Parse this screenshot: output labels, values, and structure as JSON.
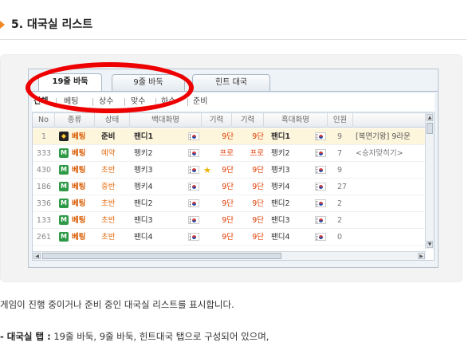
{
  "section": {
    "title": "5. 대국실 리스트"
  },
  "app": {
    "tabs": [
      {
        "label": "19줄 바둑",
        "active": true
      },
      {
        "label": "9줄 바둑",
        "active": false
      },
      {
        "label": "힌트 대국",
        "active": false
      }
    ],
    "filters": [
      {
        "label": "전체",
        "active": true
      },
      {
        "label": "베팅",
        "active": false
      },
      {
        "label": "상수",
        "active": false
      },
      {
        "label": "맞수",
        "active": false
      },
      {
        "label": "하수",
        "active": false
      },
      {
        "label": "준비",
        "active": false
      }
    ],
    "columns": [
      "No",
      "종류",
      "상태",
      "백대화명",
      "기력",
      "기력",
      "흑대화명",
      "인원"
    ],
    "rows": [
      {
        "no": "1",
        "icon": "gold-bet-icon",
        "type": "베팅",
        "status": "준비",
        "black": "팬디1",
        "star": false,
        "rank1": "9단",
        "rank2": "9단",
        "white": "팬디1",
        "viewers": "9",
        "note": "[복면기왕] 9라운",
        "highlight": true
      },
      {
        "no": "333",
        "icon": "m-icon",
        "type": "베팅",
        "status": "예약",
        "black": "펭키2",
        "star": false,
        "rank1": "프로",
        "rank2": "프로",
        "white": "펭키2",
        "viewers": "7",
        "note": "<승자맞히기>",
        "highlight": false
      },
      {
        "no": "430",
        "icon": "m-icon",
        "type": "베팅",
        "status": "초반",
        "black": "펭키3",
        "star": true,
        "rank1": "9단",
        "rank2": "9단",
        "white": "펭키3",
        "viewers": "9",
        "note": "",
        "highlight": false
      },
      {
        "no": "186",
        "icon": "m-icon",
        "type": "베팅",
        "status": "중반",
        "black": "펭키4",
        "star": false,
        "rank1": "9단",
        "rank2": "9단",
        "white": "펭키4",
        "viewers": "27",
        "note": "",
        "highlight": false
      },
      {
        "no": "336",
        "icon": "m-icon",
        "type": "베팅",
        "status": "초반",
        "black": "팬디2",
        "star": false,
        "rank1": "9단",
        "rank2": "9단",
        "white": "팬디2",
        "viewers": "2",
        "note": "",
        "highlight": false
      },
      {
        "no": "133",
        "icon": "m-icon",
        "type": "베팅",
        "status": "초반",
        "black": "팬디3",
        "star": false,
        "rank1": "9단",
        "rank2": "9단",
        "white": "팬디3",
        "viewers": "2",
        "note": "",
        "highlight": false
      },
      {
        "no": "261",
        "icon": "m-icon",
        "type": "베팅",
        "status": "초반",
        "black": "팬디4",
        "star": false,
        "rank1": "9단",
        "rank2": "9단",
        "white": "팬디4",
        "viewers": "0",
        "note": "",
        "highlight": false
      }
    ]
  },
  "description": {
    "line1": "게임이 진행 중이거나 준비 중인 대국실 리스트를 표시합니다.",
    "line2_bold": "- 대국실 탭 :",
    "line2_rest": " 19줄 바둑, 9줄 바둑, 힌트대국 탭으로 구성되어 있으며,"
  },
  "colors": {
    "accent": "#f08a24",
    "callout": "#ee0000",
    "rank": "#e03b00"
  }
}
